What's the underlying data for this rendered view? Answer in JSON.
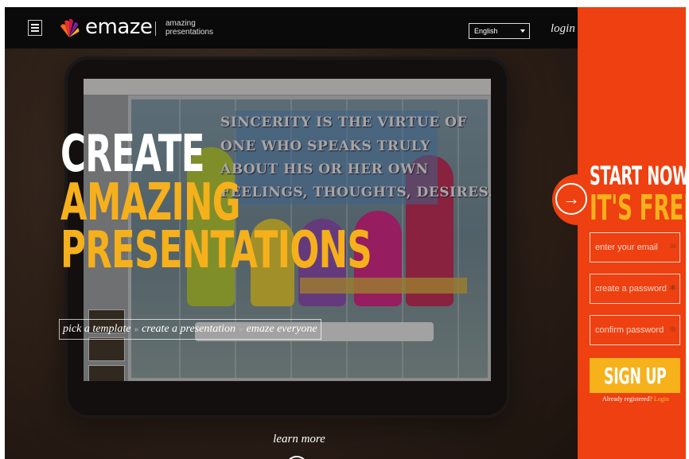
{
  "header": {
    "logo_text": "emaze",
    "tagline_line1": "amazing",
    "tagline_line2": "presentations",
    "language": "English",
    "login": "login"
  },
  "hero": {
    "line1": "CREATE",
    "line2": "AMAZING",
    "line3": "PRESENTATIONS",
    "steps": [
      "pick a template",
      "create a presentation",
      "emaze everyone"
    ],
    "learn_more": "learn more",
    "screen_quote": [
      "SINCERITY IS THE VIRTUE OF",
      "ONE WHO SPEAKS TRULY",
      "ABOUT HIS OR HER OWN",
      "FEELINGS, THOUGHTS, DESIRES."
    ]
  },
  "signup_panel": {
    "title": "START NOW!",
    "subtitle": "IT'S FREE",
    "email_placeholder": "enter your email",
    "password_placeholder": "create a password",
    "confirm_placeholder": "confirm password",
    "signup_button": "SIGN UP",
    "already_text": "Already registered?",
    "already_link": "Login"
  },
  "colors": {
    "panel": "#ee4010",
    "accent": "#f5b01c",
    "topbar": "#0a0a0a"
  },
  "icons": {
    "menu": "menu-icon",
    "logo": "emaze-logo-icon",
    "arrow": "arrow-right-icon",
    "down": "arrow-down-icon"
  }
}
